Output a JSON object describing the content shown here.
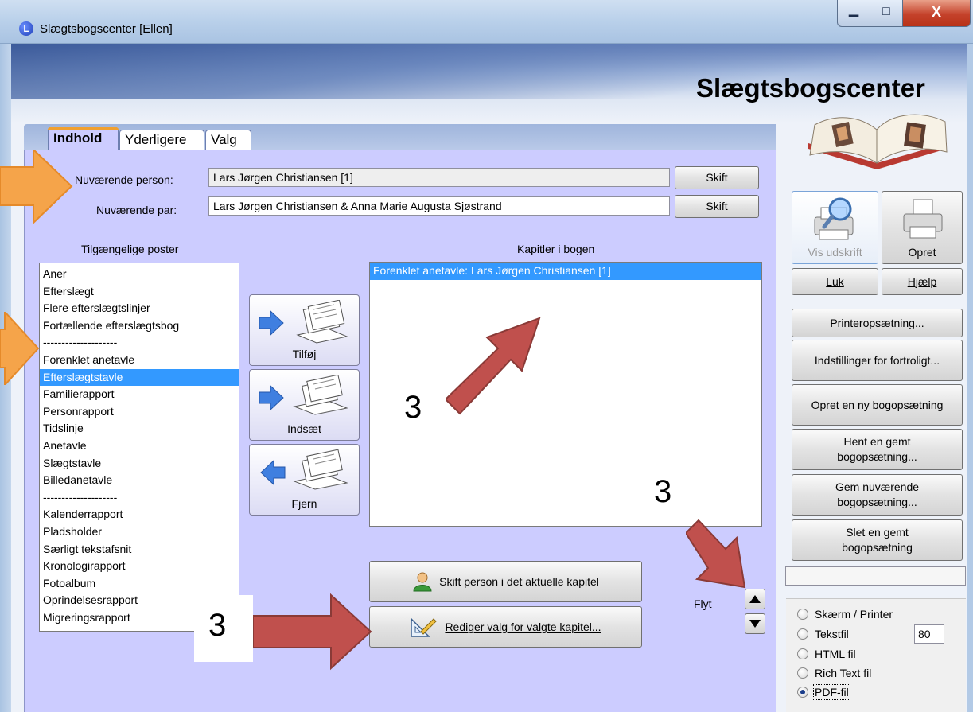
{
  "window": {
    "app_icon_letter": "L",
    "title": "Slægtsbogscenter [Ellen]",
    "minimize_glyph": "▁",
    "maximize_glyph": "□",
    "close_glyph": "X"
  },
  "header": {
    "heading": "Slægtsbogscenter"
  },
  "tabs": [
    {
      "label": "Indhold",
      "active": true
    },
    {
      "label": "Yderligere",
      "active": false
    },
    {
      "label": "Valg",
      "active": false
    }
  ],
  "current": {
    "person_label": "Nuværende person:",
    "person_value": "Lars Jørgen Christiansen [1]",
    "person_change": "Skift",
    "pair_label": "Nuværende par:",
    "pair_value": "Lars Jørgen Christiansen & Anna Marie Augusta Sjøstrand",
    "pair_change": "Skift"
  },
  "available": {
    "heading": "Tilgængelige poster",
    "items": [
      "Aner",
      "Efterslægt",
      "Flere efterslægtslinjer",
      "Fortællende efterslægtsbog",
      "--------------------",
      "Forenklet anetavle",
      "Efterslægtstavle",
      "Familierapport",
      "Personrapport",
      "Tidslinje",
      "Anetavle",
      "Slægtstavle",
      "Billedanetavle",
      "--------------------",
      "Kalenderrapport",
      "Pladsholder",
      "Særligt tekstafsnit",
      "Kronologirapport",
      "Fotoalbum",
      "Oprindelsesrapport",
      "Migreringsrapport"
    ],
    "selected_index": 6
  },
  "actions": {
    "add": "Tilføj",
    "insert": "Indsæt",
    "remove": "Fjern"
  },
  "chapters": {
    "heading": "Kapitler i bogen",
    "items": [
      "Forenklet anetavle: Lars Jørgen Christiansen [1]"
    ]
  },
  "chapter_buttons": {
    "change_person": "Skift person i det aktuelle kapitel",
    "edit_options": "Rediger valg for valgte kapitel..."
  },
  "move": {
    "label": "Flyt"
  },
  "sidebar": {
    "preview": "Vis udskrift",
    "create": "Opret",
    "close": "Luk",
    "help": "Hjælp",
    "printer_setup": "Printeropsætning...",
    "privacy": "Indstillinger for fortroligt...",
    "new_setup": "Opret en ny bogopsætning",
    "load_setup_1": "Hent en gemt",
    "load_setup_2": "bogopsætning...",
    "save_setup_1": "Gem nuværende",
    "save_setup_2": "bogopsætning...",
    "delete_setup_1": "Slet en gemt",
    "delete_setup_2": "bogopsætning"
  },
  "output": {
    "options": [
      "Skærm / Printer",
      "Tekstfil",
      "HTML fil",
      "Rich Text fil",
      "PDF-fil"
    ],
    "selected_index": 4,
    "width_value": "80"
  },
  "annotations": {
    "step_number": "3"
  },
  "colors": {
    "panel": "#ccccff",
    "selection": "#3399ff",
    "arrow_orange": "#f5a44a",
    "arrow_red": "#c0504d"
  }
}
